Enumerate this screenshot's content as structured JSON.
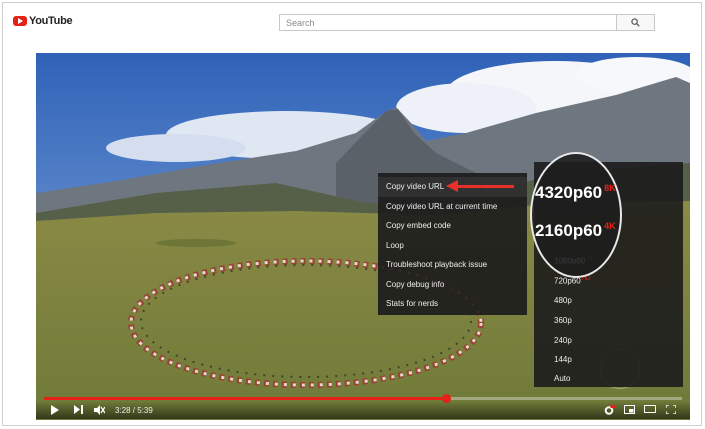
{
  "header": {
    "logo_text": "YouTube",
    "search_placeholder": "Search"
  },
  "player": {
    "time": "3:28 / 5:39",
    "progress": 0.63
  },
  "context_menu": {
    "items": [
      "Copy video URL",
      "Copy video URL at current time",
      "Copy embed code",
      "Loop",
      "Troubleshoot playback issue",
      "Copy debug info",
      "Stats for nerds"
    ]
  },
  "quality_menu": {
    "zoom": [
      {
        "label": "4320p60",
        "badge": "8K"
      },
      {
        "label": "2160p60",
        "badge": "4K"
      }
    ],
    "items": [
      {
        "label": "1080p60",
        "badge": "HD"
      },
      {
        "label": "720p60",
        "badge": "HD"
      },
      {
        "label": "480p",
        "badge": ""
      },
      {
        "label": "360p",
        "badge": ""
      },
      {
        "label": "240p",
        "badge": ""
      },
      {
        "label": "144p",
        "badge": ""
      },
      {
        "label": "Auto",
        "badge": ""
      }
    ]
  },
  "colors": {
    "brand_red": "#e62117",
    "arrow_red": "#e8302a",
    "menu_bg": "#1c1c1c"
  }
}
